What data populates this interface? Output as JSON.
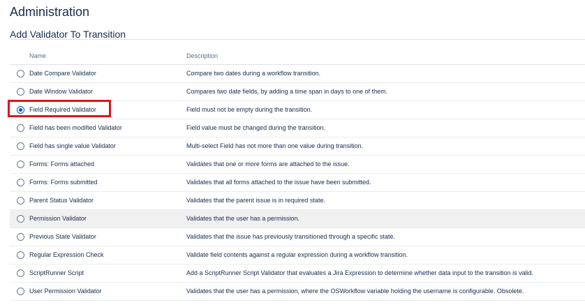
{
  "page": {
    "title": "Administration",
    "section_title": "Add Validator To Transition"
  },
  "table": {
    "columns": {
      "name": "Name",
      "description": "Description"
    },
    "rows": [
      {
        "name": "Date Compare Validator",
        "description": "Compare two dates during a workflow transition.",
        "selected": false
      },
      {
        "name": "Date Window Validator",
        "description": "Compares two date fields, by adding a time span in days to one of them.",
        "selected": false
      },
      {
        "name": "Field Required Validator",
        "description": "Field must not be empty during the transition.",
        "selected": true
      },
      {
        "name": "Field has been modified Validator",
        "description": "Field value must be changed during the transition.",
        "selected": false
      },
      {
        "name": "Field has single value Validator",
        "description": "Multi-select Field has not more than one value during transition.",
        "selected": false
      },
      {
        "name": "Forms: Forms attached",
        "description": "Validates that one or more forms are attached to the issue.",
        "selected": false
      },
      {
        "name": "Forms: Forms submitted",
        "description": "Validates that all forms attached to the issue have been submitted.",
        "selected": false
      },
      {
        "name": "Parent Status Validator",
        "description": "Validates that the parent issue is in required state.",
        "selected": false
      },
      {
        "name": "Permission Validator",
        "description": "Validates that the user has a permission.",
        "selected": false
      },
      {
        "name": "Previous State Validator",
        "description": "Validates that the issue has previously transitioned through a specific state.",
        "selected": false
      },
      {
        "name": "Regular Expression Check",
        "description": "Validate field contents against a regular expression during a workflow transition.",
        "selected": false
      },
      {
        "name": "ScriptRunner Script",
        "description": "Add a ScriptRunner Script Validator that evaluates a Jira Expression to determine whether data input to the transition is valid.",
        "selected": false
      },
      {
        "name": "User Permission Validator",
        "description": "Validates that the user has a permission, where the OSWorkflow variable holding the username is configurable. Obsolete.",
        "selected": false
      }
    ]
  },
  "colors": {
    "highlight": "#e0141e",
    "radio_selected": "#0052cc",
    "hover_row": "#f0f0f0"
  }
}
